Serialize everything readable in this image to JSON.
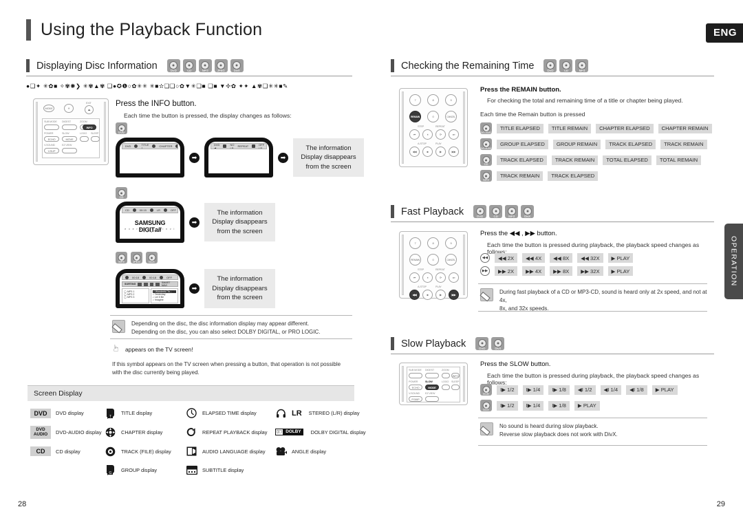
{
  "document": {
    "title": "Using the Playback Function",
    "language_badge": "ENG",
    "side_tab": "OPERATION",
    "page_left": "28",
    "page_right": "29"
  },
  "disc_labels": {
    "dvd": "DVD",
    "cd": "CD",
    "mp3": "MP3",
    "jpeg": "JPEG",
    "divx": "DivX",
    "dvd_video": "DVD-VIDEO",
    "dvd_audio": "DVD-AUDIO"
  },
  "left": {
    "section": {
      "title": "Displaying Disc Information",
      "discs": [
        "DVD",
        "CD",
        "MP3",
        "JPEG",
        "DivX"
      ],
      "intro_glyphs": "●❑✦ ✳✿■ ✧✾✺❯ ✳✾▲✾ ❑●✪❶○✿✳✳ ✳■✫❑❑○✿▼✳❑■  ❑■ ▼✢✿ ✦✦ ▲✾❑✳✳■✎"
    },
    "steps": {
      "press_info": "Press the INFO button.",
      "each_time": "Each time the button is pressed, the display changes as follows:",
      "disappear": "The information\nDisplay disappears\nfrom the screen"
    },
    "osd_rows": {
      "dvd_1": [
        "DVD",
        "TITLE 1",
        "CHAPTER",
        "00:00:01",
        "1/1"
      ],
      "dvd_2": [
        "DVD",
        "NO LR",
        "REPEAT",
        "OFF LR",
        "OFF"
      ],
      "cd_1": [
        "CD",
        "00:15",
        "LR",
        "OFF",
        "01:00:00"
      ],
      "mp3_1": [
        "MP3",
        "00:18",
        "OFF"
      ],
      "mp3_sorting": "SORTING",
      "mp3_list_title": "SMART NAVI",
      "mp3_folders": [
        "MP3 1",
        "MP3 2",
        "MP3 3"
      ],
      "mp3_files": [
        "Wonderful Tonight",
        "Yesterday",
        "Let It Be",
        "Imagine"
      ]
    },
    "note_disc": "Depending on the disc, the disc information display may appear different.\nDepending on the disc, you can also select DOLBY DIGITAL, or PRO LOGIC.",
    "hand_note": {
      "heading": "appears on the TV screen!",
      "body": "If this symbol appears on the TV screen when pressing a button, that operation is not possible with the disc currently being played."
    },
    "screen_display": {
      "heading": "Screen Display",
      "items": [
        {
          "icon": "dvd-tag",
          "tag": "DVD",
          "label": "DVD display"
        },
        {
          "icon": "title-icon",
          "label": "TITLE display"
        },
        {
          "icon": "elapsed-time-icon",
          "label": "ELAPSED TIME display"
        },
        {
          "icon": "stereo-icon",
          "label": "STEREO (L/R) display"
        },
        {
          "icon": "dvd-audio-tag",
          "tag": "DVD\nAUDIO",
          "label": "DVD-AUDIO display"
        },
        {
          "icon": "chapter-icon",
          "label": "CHAPTER display"
        },
        {
          "icon": "repeat-playback-icon",
          "label": "REPEAT PLAYBACK display"
        },
        {
          "icon": "dolby-digital-icon",
          "label": "DOLBY DIGITAL display"
        },
        {
          "icon": "cd-tag",
          "tag": "CD",
          "label": "CD display"
        },
        {
          "icon": "track-file-icon",
          "label": "TRACK (FILE) display"
        },
        {
          "icon": "audio-language-icon",
          "label": "AUDIO LANGUAGE display"
        },
        {
          "icon": "angle-icon",
          "label": "ANGLE display"
        },
        {
          "icon": "blank",
          "label": ""
        },
        {
          "icon": "group-icon",
          "label": "GROUP display"
        },
        {
          "icon": "subtitle-icon",
          "label": "SUBTITLE display"
        },
        {
          "icon": "blank2",
          "label": ""
        }
      ]
    }
  },
  "right": {
    "remaining": {
      "title": "Checking the Remaining Time",
      "discs": [
        "DVD",
        "CD",
        "MP3"
      ],
      "press": "Press the REMAIN button.",
      "purpose": "For checking the total and remaining time of a title or chapter being played.",
      "each_time": "Each time the Remain button is pressed",
      "rows": [
        {
          "disc": "DVD-VIDEO",
          "chips": [
            "TITLE ELAPSED",
            "TITLE REMAIN",
            "CHAPTER ELAPSED",
            "CHAPTER REMAIN"
          ]
        },
        {
          "disc": "DVD-AUDIO",
          "chips": [
            "GROUP ELAPSED",
            "GROUP REMAIN",
            "TRACK ELAPSED",
            "TRACK REMAIN"
          ]
        },
        {
          "disc": "CD",
          "chips": [
            "TRACK ELAPSED",
            "TRACK REMAIN",
            "TOTAL ELAPSED",
            "TOTAL REMAIN"
          ]
        },
        {
          "disc": "MP3",
          "chips": [
            "TRACK REMAIN",
            "TRACK ELAPSED"
          ]
        }
      ],
      "remote_keys": [
        "7",
        "8",
        "9",
        "REMAIN",
        "0",
        "CANCEL",
        "STEP",
        "REPEAT",
        "A-STOP",
        "PLAY"
      ]
    },
    "fast": {
      "title": "Fast Playback",
      "discs": [
        "DVD",
        "CD",
        "MP3",
        "DivX"
      ],
      "press": "Press the ◀◀ , ▶▶  button.",
      "each_time": "Each time the button is pressed during playback, the playback speed changes as follows:",
      "rows": [
        {
          "dir": "rew",
          "chips": [
            "◀◀ 2X",
            "◀◀ 4X",
            "◀◀ 8X",
            "◀◀ 32X",
            "▶ PLAY"
          ]
        },
        {
          "dir": "ff",
          "chips": [
            "▶▶ 2X",
            "▶▶ 4X",
            "▶▶ 8X",
            "▶▶ 32X",
            "▶ PLAY"
          ]
        }
      ],
      "note": "During fast playback of a CD or MP3-CD, sound is heard only at 2x speed, and not at 4x, 8x, and 32x speeds."
    },
    "slow": {
      "title": "Slow Playback",
      "discs": [
        "DVD",
        "DivX"
      ],
      "press": "Press the SLOW button.",
      "each_time": "Each time the button is pressed during playback, the playback speed changes as follows:",
      "rows": [
        {
          "disc": "DVD",
          "chips": [
            "I▶ 1/2",
            "I▶ 1/4",
            "I▶ 1/8",
            "◀I 1/2",
            "◀I 1/4",
            "◀I 1/8",
            "▶ PLAY"
          ]
        },
        {
          "disc": "DivX",
          "chips": [
            "I▶ 1/2",
            "I▶ 1/4",
            "I▶ 1/8",
            "▶ PLAY"
          ]
        }
      ],
      "note": "No sound is heard during slow playback.\nReverse slow playback does not work with DivX."
    }
  },
  "remote_left": {
    "top_caps": [
      "EXIT"
    ],
    "keys": [
      "SUB MODE",
      "DIGEST",
      "ZOOM",
      "INFO",
      "POWER",
      "SLOW",
      "LOGO",
      "SLEEP",
      "ECHO",
      "MOVE",
      "V-SOUND",
      "EZ VIEW",
      "VIEW"
    ]
  },
  "remote_slow": {
    "keys": [
      "SUB MODE",
      "DIGEST",
      "ZOOM",
      "INFO",
      "POWER",
      "SLOW",
      "LOGO",
      "SLEEP",
      "ECHO",
      "MODE",
      "V-SOUND",
      "EZ VIEW",
      "P.SKIP"
    ]
  }
}
